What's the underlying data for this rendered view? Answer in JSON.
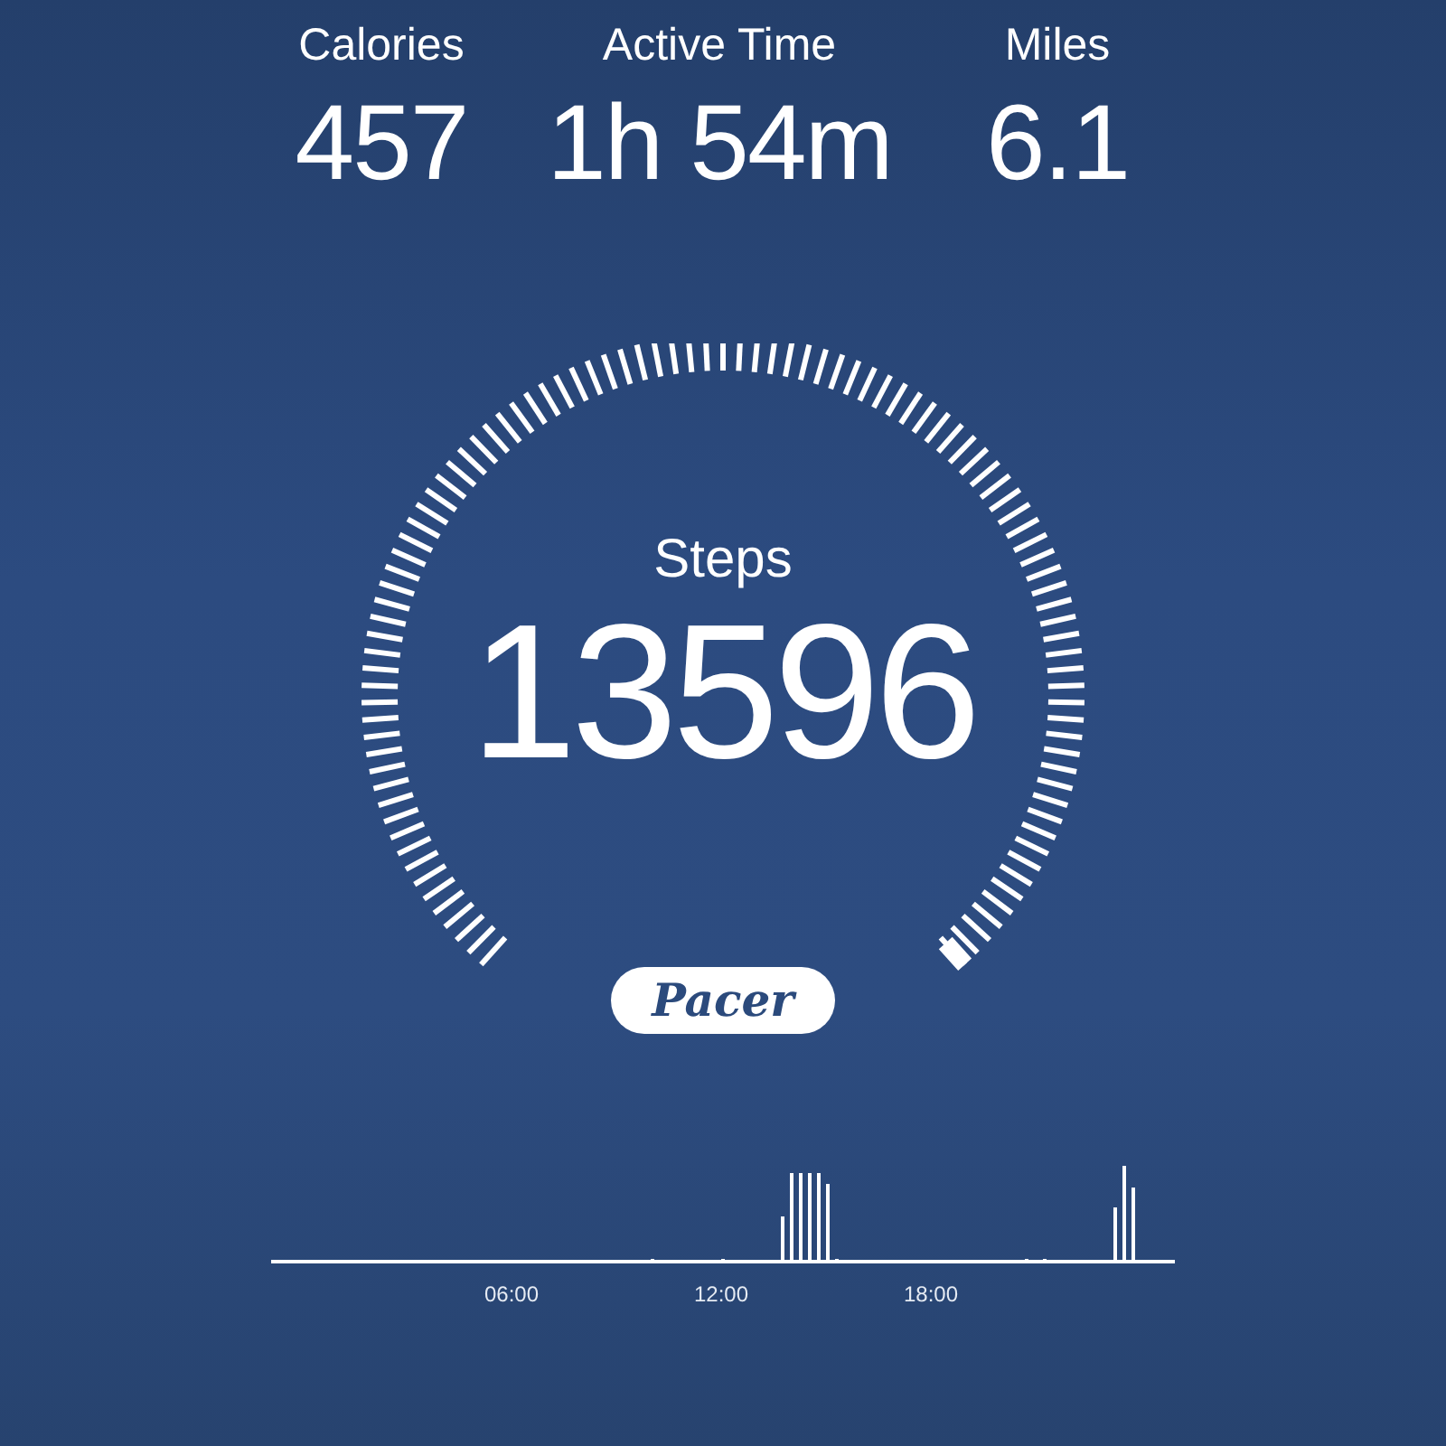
{
  "stats": [
    {
      "label": "Calories",
      "value": "457"
    },
    {
      "label": "Active Time",
      "value": "1h 54m"
    },
    {
      "label": "Miles",
      "value": "6.1"
    }
  ],
  "steps": {
    "label": "Steps",
    "value": "13596"
  },
  "brand": {
    "label": "Pacer"
  },
  "activity": {
    "time_labels": [
      "06:00",
      "12:00",
      "18:00"
    ]
  }
}
